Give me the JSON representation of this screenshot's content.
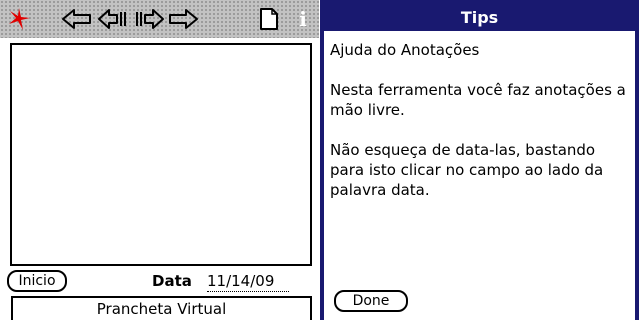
{
  "app": {
    "toolbar": {
      "menu_icon": "red-star-icon",
      "nav_icons": [
        "first-arrow-icon",
        "prev-arrow-icon",
        "next-arrow-icon",
        "last-arrow-icon"
      ],
      "new_note_icon": "new-page-icon",
      "info_label": "i",
      "accent_color": "#e00000"
    },
    "bottom": {
      "inicio_label": "Inicio",
      "data_label": "Data",
      "data_value": "11/14/09"
    },
    "footer_title": "Prancheta Virtual"
  },
  "tips": {
    "title": "Tips",
    "header_color": "#191970",
    "paragraphs": [
      "Ajuda do Anotações",
      "Nesta ferramenta você faz anotações a mão livre.",
      "Não esqueça de data-las, bastando para isto clicar no campo ao lado da palavra data."
    ],
    "done_label": "Done"
  }
}
